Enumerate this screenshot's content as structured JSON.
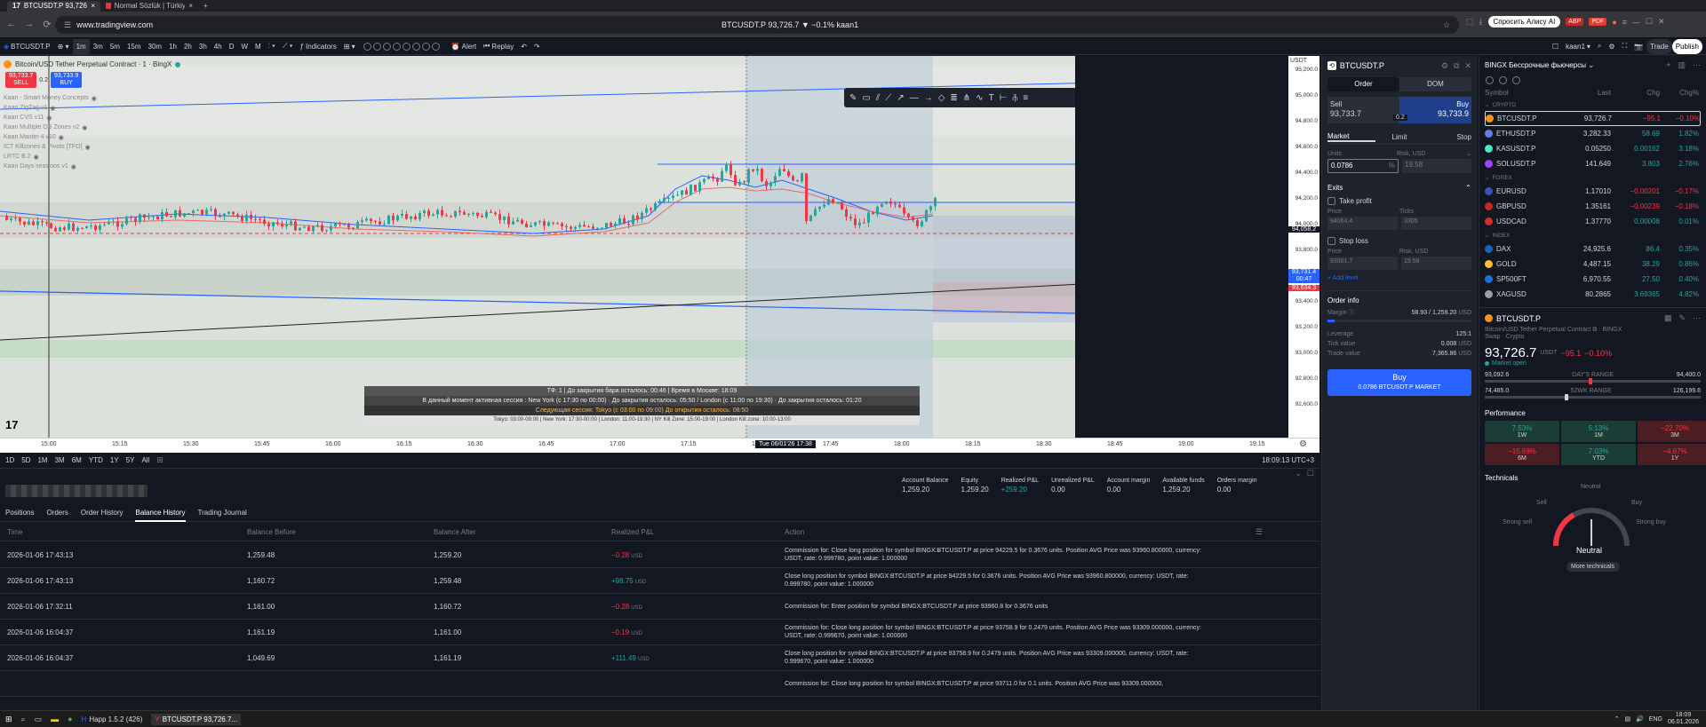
{
  "browser": {
    "tabs": [
      {
        "label": "BTCUSDT.P 93,726.7 ▼ −0..."
      },
      {
        "label": "Normal Sözlük | Türkiye'n..."
      }
    ],
    "url": "www.tradingview.com",
    "page_title": "BTCUSDT.P 93,726.7 ▼ −0.1% kaan1",
    "profile": "kaan1",
    "alice_label": "Спросить Алису AI"
  },
  "toolbar": {
    "symbol": "BTCUSDT.P",
    "timeframes": [
      "1m",
      "3m",
      "5m",
      "15m",
      "30m",
      "1h",
      "2h",
      "3h",
      "4h",
      "D",
      "W",
      "M"
    ],
    "selected_tf": "1m",
    "indicators_label": "Indicators",
    "alert_label": "Alert",
    "replay_label": "Replay",
    "account_label": "kaan1",
    "trade_label": "Trade",
    "publish_label": "Publish"
  },
  "chart": {
    "title": "Bitcoin/USD Tether Perpetual Contract · 1 · BingX",
    "sell_price": "93,733.7",
    "sell_label": "SELL",
    "spread": "0.2",
    "buy_price": "93,733.9",
    "buy_label": "BUY",
    "indicators": [
      "Kaan - Smart Money Concepts",
      "Kaan ZigZag v1",
      "Kaan CVS v11",
      "Kaan Multiple OB Zones v2",
      "Kaan Master 4 v10",
      "ICT Killzones & Pivots [TFO]",
      "LRTC B.2",
      "Kaan Days sessions v1"
    ],
    "currency": "USDT",
    "price_ticks": [
      "95,200.0",
      "95,000.0",
      "94,800.0",
      "94,600.0",
      "94,400.0",
      "94,200.0",
      "94,000.0",
      "93,800.0",
      "93,600.0",
      "93,400.0",
      "93,200.0",
      "93,000.0",
      "92,800.0",
      "92,600.0"
    ],
    "price_badges": {
      "high": "94,058.2",
      "current": "93,731.4",
      "timer": "00:47",
      "line": "93,634.3"
    },
    "time_ticks": [
      "15:00",
      "15:15",
      "15:30",
      "15:45",
      "16:00",
      "16:15",
      "16:30",
      "16:45",
      "17:00",
      "17:15",
      "17:30",
      "17:45",
      "18:00",
      "18:15",
      "18:30",
      "18:45",
      "19:00",
      "19:15"
    ],
    "crosshair_time": "Tue 06/01'26   17:38",
    "info": {
      "line1": "ТФ: 1 | До закрытия бара осталось: 00:46 | Время в Москве: 18:09",
      "line2": "В данный момент активная сессия : New York (с 17:30 по 00:00)  · До закрытия осталось: 05:50    /    London (с 11:00 по 19:30) · До закрытия осталось: 01:20",
      "line3": "Следующая сессия: Tokyo (с 03:00 по 09:00) До открытия осталось: 08:50",
      "line4": "Tokyo: 03:00-09:00 | New York: 17:30-00:00 | London: 11:00-19:30 | NY Kill Zone: 15:00-19:00 | London Kill zone: 10:00-13:00"
    },
    "logo": "17"
  },
  "range_bar": {
    "ranges": [
      "1D",
      "5D",
      "1M",
      "3M",
      "6M",
      "YTD",
      "1Y",
      "5Y",
      "All"
    ],
    "clock": "18:09:13 UTC+3"
  },
  "account": {
    "fields": [
      {
        "label": "Account Balance",
        "value": "1,259.20"
      },
      {
        "label": "Equity",
        "value": "1,259.20"
      },
      {
        "label": "Realized P&L",
        "value": "+259.20"
      },
      {
        "label": "Unrealized P&L",
        "value": "0.00"
      },
      {
        "label": "Account margin",
        "value": "0.00"
      },
      {
        "label": "Available funds",
        "value": "1,259.20"
      },
      {
        "label": "Orders margin",
        "value": "0.00"
      }
    ],
    "tabs": [
      "Positions",
      "Orders",
      "Order History",
      "Balance History",
      "Trading Journal"
    ],
    "active_tab": "Balance History",
    "columns": [
      "Time",
      "Balance Before",
      "Balance After",
      "Realized P&L",
      "Action"
    ],
    "rows": [
      {
        "time": "2026-01-06 17:43:13",
        "before": "1,259.48",
        "after": "1,259.20",
        "pnl": "−0.28",
        "unit": "USD",
        "pos": false,
        "action": "Commission for: Close long position for symbol BINGX:BTCUSDT.P at price 94229.5 for 0.3676 units. Position AVG Price was 93960.800000, currency: USDT, rate: 0.999780, point value: 1.000000"
      },
      {
        "time": "2026-01-06 17:43:13",
        "before": "1,160.72",
        "after": "1,259.48",
        "pnl": "+98.75",
        "unit": "USD",
        "pos": true,
        "action": "Close long position for symbol BINGX:BTCUSDT.P at price 94229.5 for 0.3676 units. Position AVG Price was 93960.800000, currency: USDT, rate: 0.999780, point value: 1.000000"
      },
      {
        "time": "2026-01-06 17:32:11",
        "before": "1,161.00",
        "after": "1,160.72",
        "pnl": "−0.28",
        "unit": "USD",
        "pos": false,
        "action": "Commission for: Enter position for symbol BINGX:BTCUSDT.P at price 93960.8 for 0.3676 units"
      },
      {
        "time": "2026-01-06 16:04:37",
        "before": "1,161.19",
        "after": "1,161.00",
        "pnl": "−0.19",
        "unit": "USD",
        "pos": false,
        "action": "Commission for: Close long position for symbol BINGX:BTCUSDT.P at price 93758.9 for 0.2479 units. Position AVG Price was 93309.000000, currency: USDT, rate: 0.999670, point value: 1.000000"
      },
      {
        "time": "2026-01-06 16:04:37",
        "before": "1,049.69",
        "after": "1,161.19",
        "pnl": "+111.49",
        "unit": "USD",
        "pos": true,
        "action": "Close long position for symbol BINGX:BTCUSDT.P at price 93758.9 for 0.2479 units. Position AVG Price was 93309.000000, currency: USDT, rate: 0.999670, point value: 1.000000"
      },
      {
        "time": "",
        "before": "",
        "after": "",
        "pnl": "",
        "unit": "",
        "pos": false,
        "action": "Commission for: Close long position for symbol BINGX:BTCUSDT.P at price 93711.0 for 0.1 units. Position AVG Price was 93309.000000,"
      }
    ]
  },
  "order_panel": {
    "symbol": "BTCUSDT.P",
    "tabs": [
      "Order",
      "DOM"
    ],
    "sell_label": "Sell",
    "sell_price": "93,733.7",
    "spread": "0.2",
    "buy_label": "Buy",
    "buy_price": "93,733.9",
    "types": [
      "Market",
      "Limit",
      "Stop"
    ],
    "units_label": "Units",
    "risk_label": "Risk, USD",
    "units_value": "0.0786",
    "units_pct": "%",
    "risk_value": "19.58",
    "exits_label": "Exits",
    "tp_label": "Take profit",
    "price_label": "Price",
    "ticks_label": "Ticks",
    "tp_price": "94064.4",
    "tp_ticks": "3305",
    "sl_label": "Stop loss",
    "sl_price": "93501.7",
    "sl_risk": "19.58",
    "add_level": "+ Add level",
    "info_title": "Order info",
    "margin_label": "Margin",
    "margin_value": "58.93 / 1,259.20",
    "margin_fill": 0.05,
    "leverage_label": "Leverage",
    "leverage_value": "125:1",
    "tick_label": "Tick value",
    "tick_value": "0.008",
    "trade_label": "Trade value",
    "trade_value": "7,365.86",
    "usd": "USD",
    "buy_btn": "Buy",
    "buy_btn_sub": "0.0786 BTCUSDT.P MARKET"
  },
  "watchlist": {
    "title": "BINGX Бессрочные фьючерсы",
    "columns": [
      "Symbol",
      "Last",
      "Chg",
      "Chg%"
    ],
    "sections": [
      {
        "name": "CRYPTO",
        "rows": [
          {
            "sym": "BTCUSDT.P",
            "last": "93,726.7",
            "chg": "−95.1",
            "pct": "−0.10%",
            "up": false,
            "color": "#f7931a"
          },
          {
            "sym": "ETHUSDT.P",
            "last": "3,282.33",
            "chg": "58.69",
            "pct": "1.82%",
            "up": true,
            "color": "#627eea"
          },
          {
            "sym": "KASUSDT.P",
            "last": "0.05250",
            "chg": "0.00162",
            "pct": "3.18%",
            "up": true,
            "color": "#49eacb"
          },
          {
            "sym": "SOLUSDT.P",
            "last": "141.649",
            "chg": "3.803",
            "pct": "2.76%",
            "up": true,
            "color": "#9945ff"
          }
        ]
      },
      {
        "name": "FOREX",
        "rows": [
          {
            "sym": "EURUSD",
            "last": "1.17010",
            "chg": "−0.00201",
            "pct": "−0.17%",
            "up": false,
            "color": "#3f51b5"
          },
          {
            "sym": "GBPUSD",
            "last": "1.35161",
            "chg": "−0.00239",
            "pct": "−0.18%",
            "up": false,
            "color": "#c62828"
          },
          {
            "sym": "USDCAD",
            "last": "1.37770",
            "chg": "0.00008",
            "pct": "0.01%",
            "up": true,
            "color": "#d32f2f"
          }
        ]
      },
      {
        "name": "INDEX",
        "rows": [
          {
            "sym": "DAX",
            "last": "24,925.6",
            "chg": "86.4",
            "pct": "0.35%",
            "up": true,
            "color": "#1565c0"
          },
          {
            "sym": "GOLD",
            "last": "4,487.15",
            "chg": "38.29",
            "pct": "0.86%",
            "up": true,
            "color": "#fbc02d"
          },
          {
            "sym": "SP500FT",
            "last": "6,970.55",
            "chg": "27.50",
            "pct": "0.40%",
            "up": true,
            "color": "#1976d2"
          },
          {
            "sym": "XAGUSD",
            "last": "80.2865",
            "chg": "3.69365",
            "pct": "4.82%",
            "up": true,
            "color": "#9e9e9e"
          }
        ]
      }
    ]
  },
  "details": {
    "symbol": "BTCUSDT.P",
    "desc": "Bitcoin/USD Tether Perpetual Contract",
    "exchange": "BINGX",
    "sub": "Swap · Crypto",
    "price": "93,726.7",
    "currency": "USDT",
    "chg": "−95.1",
    "pct": "−0.10%",
    "status": "Market open",
    "day_low": "93,092.6",
    "day_label": "DAY'S RANGE",
    "day_high": "94,400.0",
    "day_pos": 0.48,
    "wk_low": "74,485.0",
    "wk_label": "52WK RANGE",
    "wk_high": "126,199.6",
    "wk_pos": 0.37,
    "perf_title": "Performance",
    "perf": [
      {
        "v": "7.53%",
        "l": "1W",
        "up": true
      },
      {
        "v": "5.13%",
        "l": "1M",
        "up": true
      },
      {
        "v": "−22.70%",
        "l": "3M",
        "up": false
      },
      {
        "v": "−15.69%",
        "l": "6M",
        "up": false
      },
      {
        "v": "7.03%",
        "l": "YTD",
        "up": true
      },
      {
        "v": "−4.67%",
        "l": "1Y",
        "up": false
      }
    ],
    "tech_title": "Technicals",
    "gauge": {
      "neutral_top": "Neutral",
      "sell": "Sell",
      "buy": "Buy",
      "strong_sell": "Strong sell",
      "strong_buy": "Strong buy",
      "result": "Neutral"
    },
    "more_tech": "More technicals"
  },
  "taskbar": {
    "apps": [
      "Happ 1.5.2 (426)",
      "BTCUSDT.P 93,726.7..."
    ],
    "lang": "ENG",
    "time": "18:09",
    "date": "06.01.2026"
  }
}
